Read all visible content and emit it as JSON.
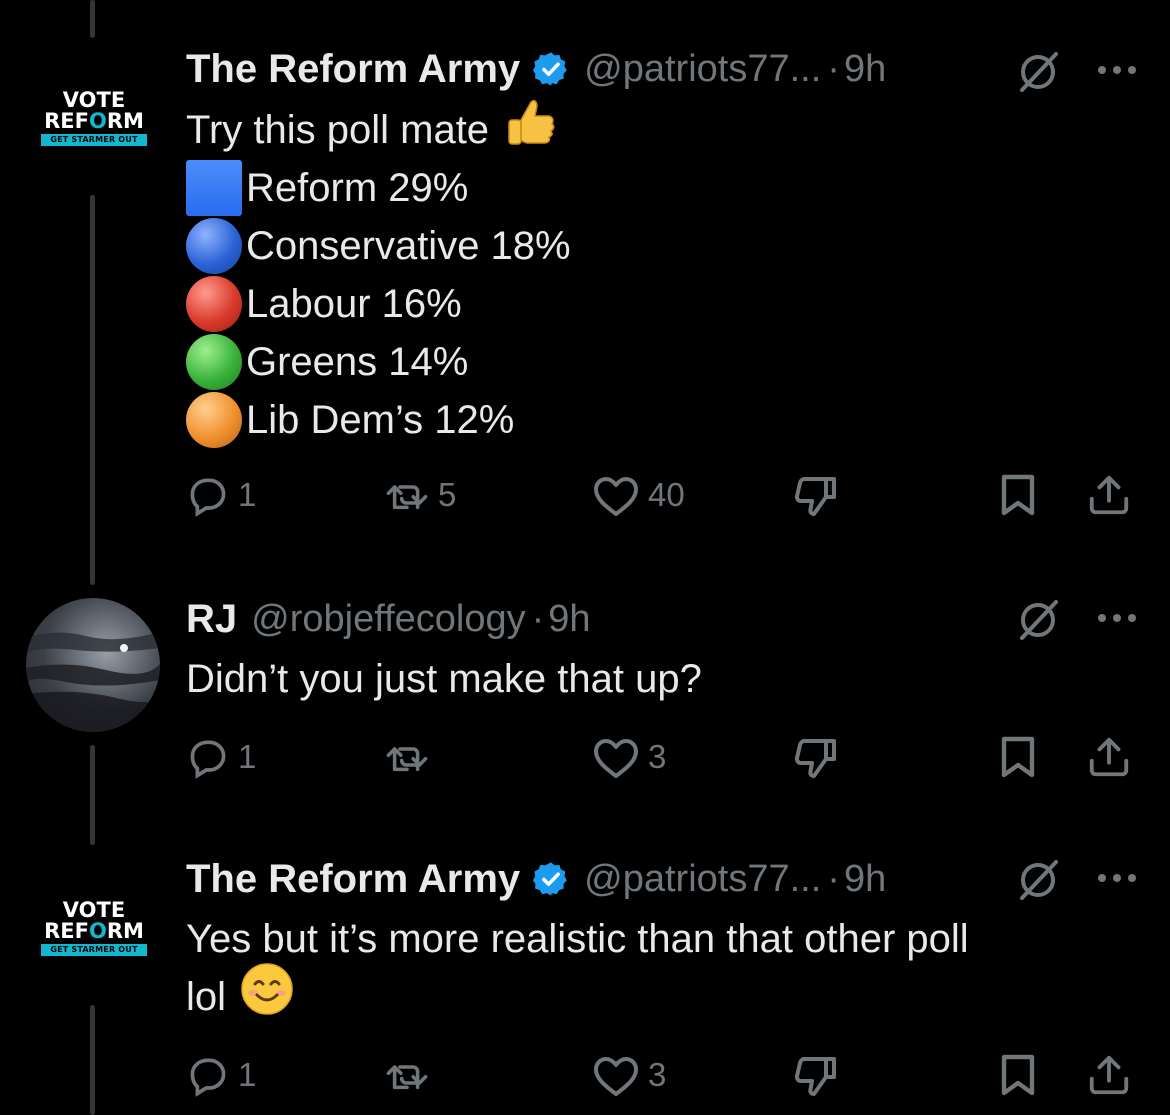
{
  "tweets": [
    {
      "author": "The Reform Army",
      "handle": "@patriots77...",
      "time": "9h",
      "avatar": {
        "line1": "VOTE",
        "line2a": "REF",
        "line2o": "O",
        "line2b": "RM",
        "line3": "GET STARMER OUT"
      },
      "lines": [
        {
          "text": "Try this poll mate",
          "emoji": "thumbs-up"
        },
        {
          "text": "Reform 29%",
          "marker": "square",
          "color": "#2f6ff2"
        },
        {
          "text": "Conservative 18%",
          "marker": "circle",
          "color": "#2c63d6"
        },
        {
          "text": "Labour 16%",
          "marker": "circle",
          "color": "#d93a2b"
        },
        {
          "text": "Greens 14%",
          "marker": "circle",
          "color": "#3ab33a"
        },
        {
          "text": "Lib Dem’s 12%",
          "marker": "circle",
          "color": "#f0902e"
        }
      ],
      "replies": "1",
      "reposts": "5",
      "likes": "40"
    },
    {
      "author": "RJ",
      "handle": "@robjeffecology",
      "time": "9h",
      "lines": [
        {
          "text": "Didn’t you just make that up?"
        }
      ],
      "replies": "1",
      "reposts": "",
      "likes": "3"
    },
    {
      "author": "The Reform Army",
      "handle": "@patriots77...",
      "time": "9h",
      "avatar": {
        "line1": "VOTE",
        "line2a": "REF",
        "line2o": "O",
        "line2b": "RM",
        "line3": "GET STARMER OUT"
      },
      "lines": [
        {
          "text": "Yes but it’s more realistic than that other poll"
        },
        {
          "text": "lol",
          "emoji": "smiling-face"
        }
      ],
      "replies": "1",
      "reposts": "",
      "likes": "3"
    }
  ],
  "separator": "·",
  "colors": {
    "background": "#000000",
    "text": "#e7e9ea",
    "muted": "#71767b",
    "verified": "#1d9bf0",
    "thread_line": "#333639",
    "logo_accent": "#12b6cf"
  },
  "icons": [
    "verified-badge-icon",
    "grok-icon",
    "more-icon",
    "reply-icon",
    "repost-icon",
    "like-icon",
    "downvote-icon",
    "bookmark-icon",
    "share-icon"
  ]
}
